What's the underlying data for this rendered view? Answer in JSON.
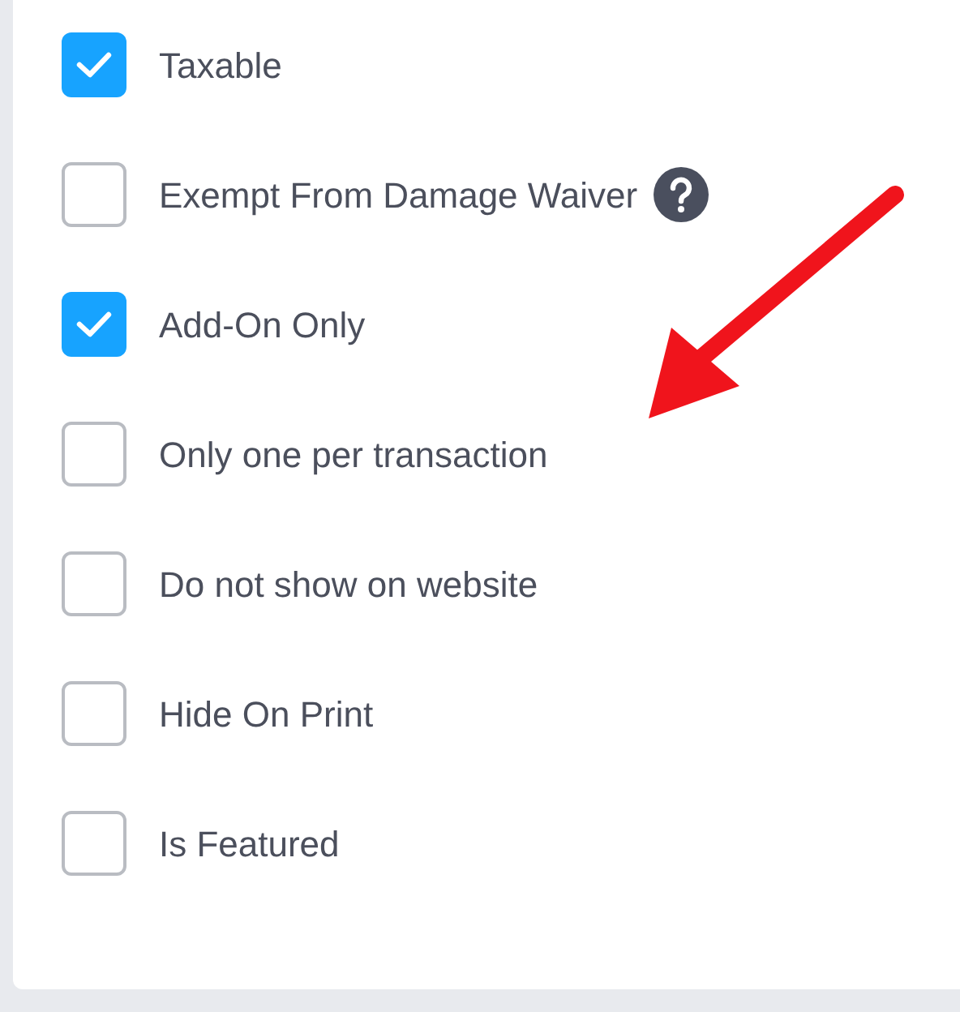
{
  "options": [
    {
      "label": "Taxable",
      "checked": true,
      "help": false
    },
    {
      "label": "Exempt From Damage Waiver",
      "checked": false,
      "help": true
    },
    {
      "label": "Add-On Only",
      "checked": true,
      "help": false
    },
    {
      "label": "Only one per transaction",
      "checked": false,
      "help": false
    },
    {
      "label": "Do not show on website",
      "checked": false,
      "help": false
    },
    {
      "label": "Hide On Print",
      "checked": false,
      "help": false
    },
    {
      "label": "Is Featured",
      "checked": false,
      "help": false
    }
  ]
}
